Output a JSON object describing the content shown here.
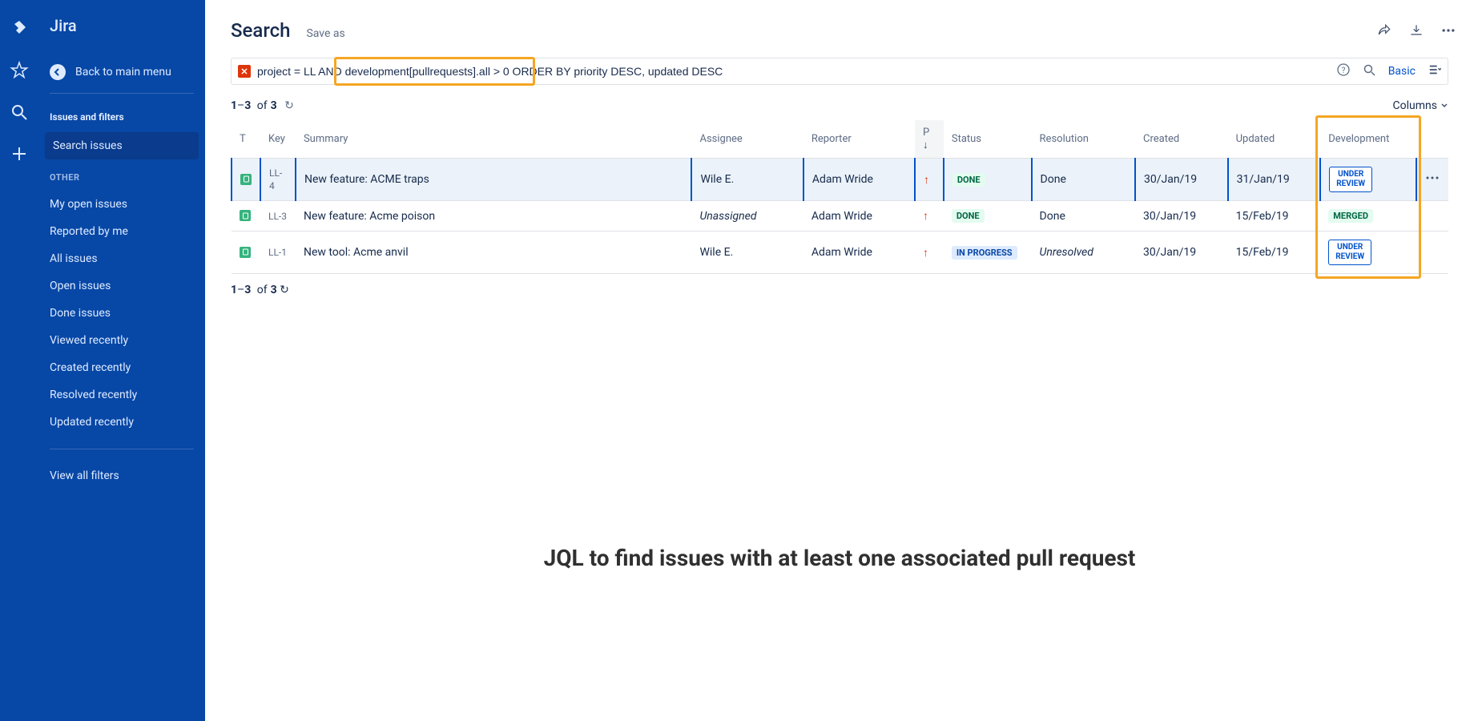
{
  "product": "Jira",
  "back_label": "Back to main menu",
  "section_header": "Issues and filters",
  "nav": {
    "active": "Search issues",
    "other_label": "OTHER",
    "items": [
      "My open issues",
      "Reported by me",
      "All issues",
      "Open issues",
      "Done issues",
      "Viewed recently",
      "Created recently",
      "Resolved recently",
      "Updated recently"
    ],
    "view_all": "View all filters"
  },
  "page_title": "Search",
  "save_as": "Save as",
  "jql": "project = LL AND development[pullrequests].all > 0 ORDER BY priority DESC, updated DESC",
  "basic_link": "Basic",
  "count": {
    "from": "1",
    "to": "3",
    "of": "3",
    "of_word": "of",
    "dash": "–"
  },
  "columns_label": "Columns",
  "headers": {
    "type": "T",
    "key": "Key",
    "summary": "Summary",
    "assignee": "Assignee",
    "reporter": "Reporter",
    "p": "P",
    "status": "Status",
    "resolution": "Resolution",
    "created": "Created",
    "updated": "Updated",
    "dev": "Development"
  },
  "rows": [
    {
      "key": "LL-4",
      "summary": "New feature: ACME traps",
      "assignee": "Wile E.",
      "reporter": "Adam Wride",
      "status": "DONE",
      "status_cls": "lz-done",
      "resolution": "Done",
      "created": "30/Jan/19",
      "updated": "31/Jan/19",
      "dev": "UNDER REVIEW",
      "dev_cls": "lz-review",
      "selected": true,
      "assignee_italic": false,
      "res_italic": false
    },
    {
      "key": "LL-3",
      "summary": "New feature: Acme poison",
      "assignee": "Unassigned",
      "reporter": "Adam Wride",
      "status": "DONE",
      "status_cls": "lz-done",
      "resolution": "Done",
      "created": "30/Jan/19",
      "updated": "15/Feb/19",
      "dev": "MERGED",
      "dev_cls": "lz-merged",
      "selected": false,
      "assignee_italic": true,
      "res_italic": false
    },
    {
      "key": "LL-1",
      "summary": "New tool: Acme anvil",
      "assignee": "Wile E.",
      "reporter": "Adam Wride",
      "status": "IN PROGRESS",
      "status_cls": "lz-prog",
      "resolution": "Unresolved",
      "created": "30/Jan/19",
      "updated": "15/Feb/19",
      "dev": "UNDER REVIEW",
      "dev_cls": "lz-review",
      "selected": false,
      "assignee_italic": false,
      "res_italic": true
    }
  ],
  "caption": "JQL to find issues with at least one associated pull request"
}
